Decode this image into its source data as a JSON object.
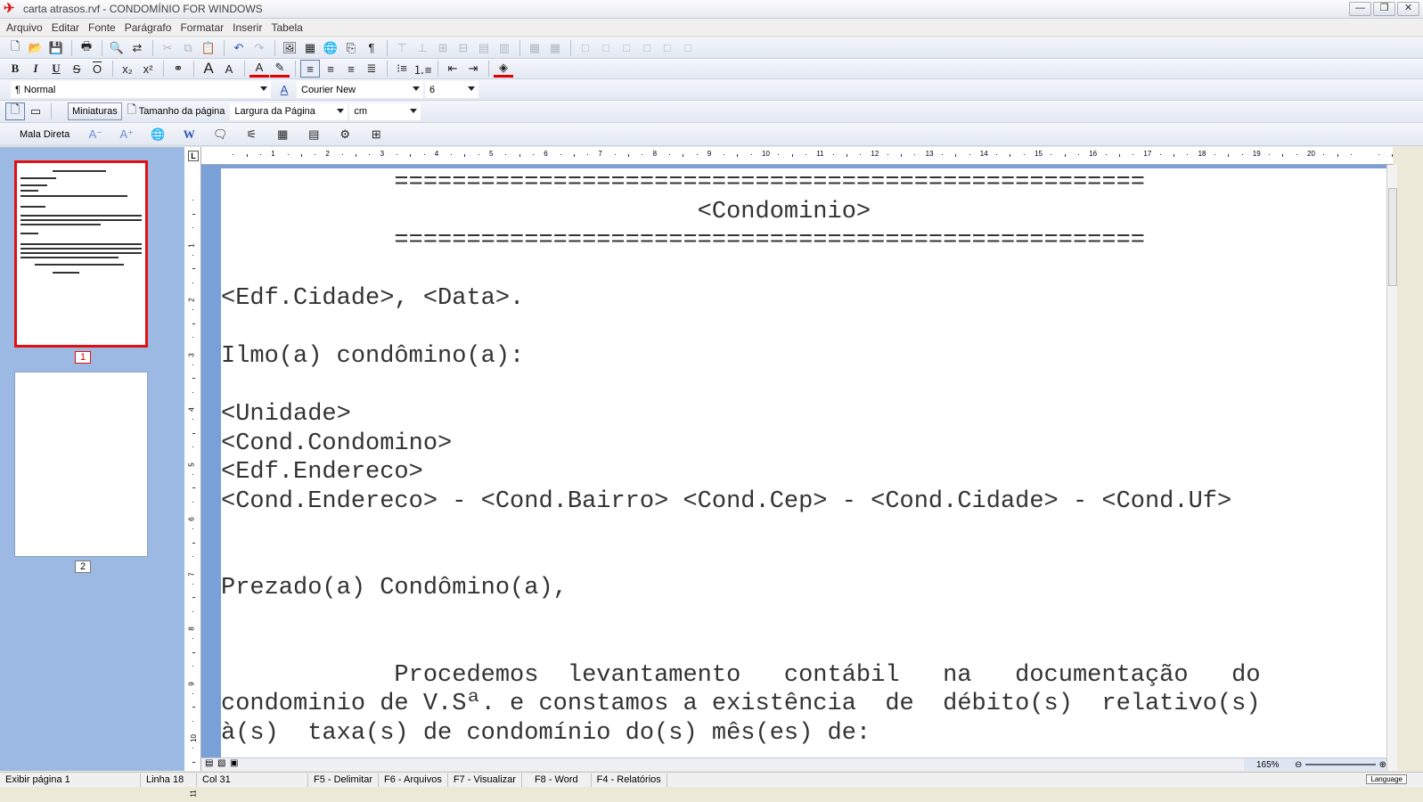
{
  "window": {
    "title": "carta atrasos.rvf - CONDOMÍNIO FOR WINDOWS",
    "buttons": {
      "minimize": "—",
      "restore": "❐",
      "close": "✕"
    }
  },
  "menu": [
    "Arquivo",
    "Editar",
    "Fonte",
    "Parágrafo",
    "Formatar",
    "Inserir",
    "Tabela"
  ],
  "format_bar": {
    "style": "Normal",
    "style_mark": "¶",
    "font_icon": "A",
    "font": "Courier New",
    "size": "6"
  },
  "view_bar": {
    "miniaturas": "Miniaturas",
    "page_size": "Tamanho da página",
    "zoom_mode": "Largura da Página",
    "unit": "cm"
  },
  "mail_bar": {
    "mala_direta": "Mala Direta"
  },
  "toolbar_icons": [
    "new-doc-icon",
    "open-folder-icon",
    "save-icon",
    "print-icon",
    "find-icon",
    "replace-icon",
    "cut-icon",
    "copy-icon",
    "paste-icon",
    "undo-icon",
    "redo-icon",
    "image-icon",
    "table-icon",
    "globe-icon",
    "frame-icon",
    "pilcrow-icon"
  ],
  "thumbnails": [
    {
      "num": "1",
      "active": true
    },
    {
      "num": "2",
      "active": false
    }
  ],
  "ruler_corner": "L",
  "hruler_numbers": [
    "1",
    "2",
    "3",
    "4",
    "5",
    "6",
    "7",
    "8",
    "9",
    "10",
    "11",
    "12",
    "13",
    "14",
    "15",
    "16",
    "17",
    "18",
    "19",
    "20"
  ],
  "vruler_numbers": [
    "1",
    "2",
    "3",
    "4",
    "5",
    "6",
    "7",
    "8",
    "9",
    "10",
    "11"
  ],
  "document": {
    "lines": [
      "            ====================================================",
      "                                 <Condominio>",
      "            ====================================================",
      "",
      "<Edf.Cidade>, <Data>.",
      "",
      "Ilmo(a) condômino(a):",
      "",
      "<Unidade>",
      "<Cond.Condomino>",
      "<Edf.Endereco>",
      "<Cond.Endereco> - <Cond.Bairro> <Cond.Cep> - <Cond.Cidade> - <Cond.Uf>",
      "",
      "",
      "Prezado(a) Condômino(a),",
      "",
      "",
      "            Procedemos  levantamento   contábil   na   documentação   do",
      "condominio de V.Sª. e constamos a existência  de  débito(s)  relativo(s)",
      "à(s)  taxa(s) de condomínio do(s) mês(es) de:"
    ]
  },
  "zoom": "165%",
  "status": {
    "page": "Exibir página 1",
    "line": "Linha 18",
    "col": "Col 31",
    "f5": "F5 - Delimitar",
    "f6": "F6 - Arquivos",
    "f7": "F7 - Visualizar",
    "f8": "F8 - Word",
    "f4": "F4 - Relatórios",
    "language": "Language"
  }
}
